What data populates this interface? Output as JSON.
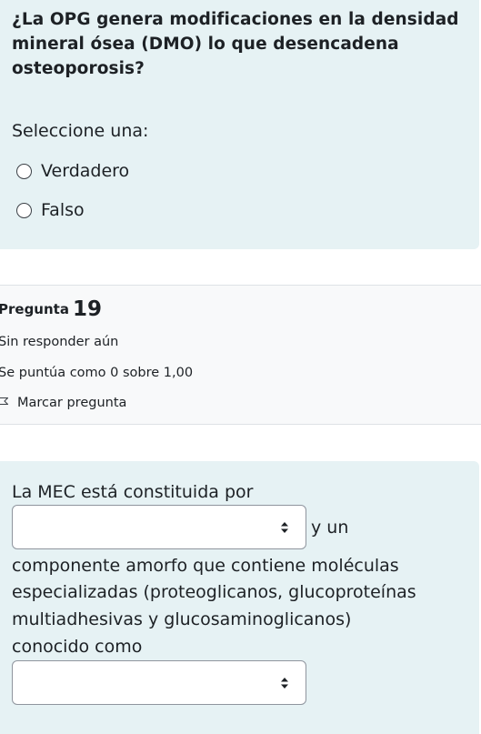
{
  "question18": {
    "text": "¿La OPG genera modificaciones en la densidad mineral ósea (DMO) lo que desencadena osteoporosis?",
    "prompt": "Seleccione una:",
    "options": [
      {
        "label": "Verdadero",
        "selected": false
      },
      {
        "label": "Falso",
        "selected": false
      }
    ]
  },
  "question19": {
    "label": "Pregunta",
    "number": "19",
    "state": "Sin responder aún",
    "grade": "Se puntúa como 0 sobre 1,00",
    "flag_label": "Marcar pregunta",
    "flag_icon": "flag-icon",
    "text_part1": "La MEC está constituida por",
    "select1_value": "",
    "text_part2": "y un",
    "text_part3": "componente amorfo que contiene moléculas",
    "text_part4": "especializadas (proteoglicanos, glucoproteínas",
    "text_part5": "multiadhesivas y glucosaminoglicanos)",
    "text_part6": "conocido como",
    "select2_value": ""
  },
  "colors": {
    "content_bg": "#e6f2f4",
    "info_bg": "#f8f9fa",
    "text": "#1d2125"
  }
}
